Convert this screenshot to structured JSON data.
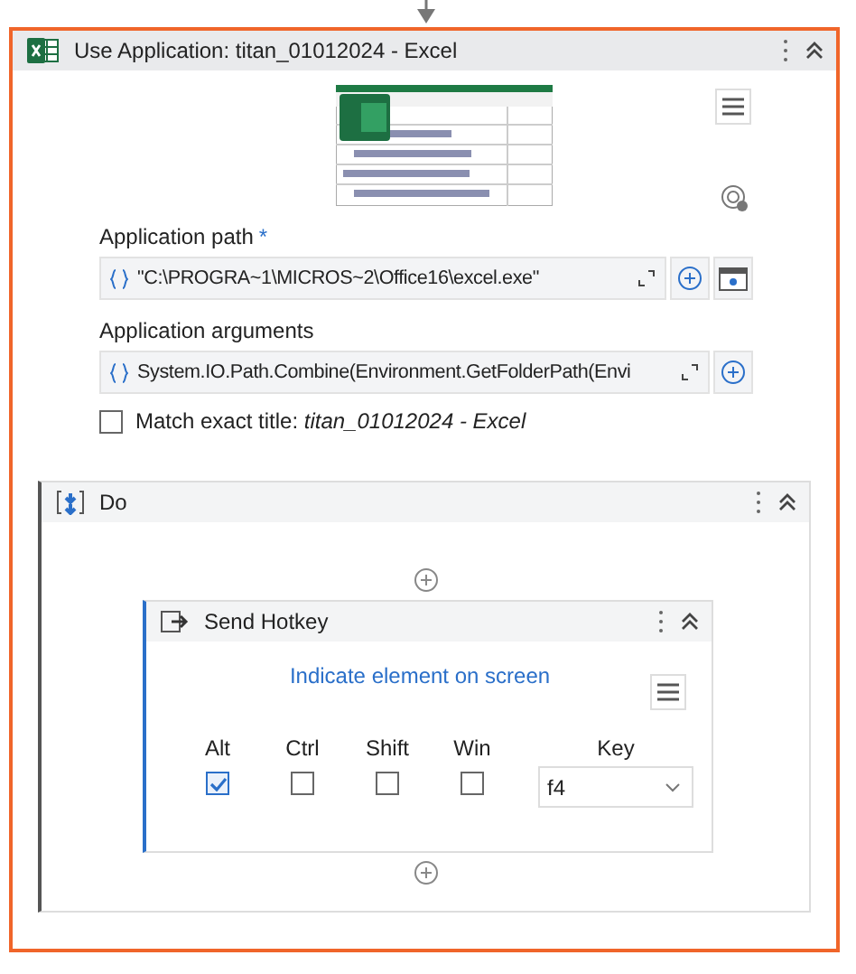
{
  "activity": {
    "title": "Use Application: titan_01012024 - Excel",
    "fields": [
      {
        "label": "Application path",
        "required_mark": "*",
        "value": "\"C:\\PROGRA~1\\MICROS~2\\Office16\\excel.exe\"",
        "browse": true
      },
      {
        "label": "Application arguments",
        "value": "System.IO.Path.Combine(Environment.GetFolderPath(Envi",
        "browse": false
      }
    ],
    "match_exact_title": {
      "label": "Match exact title: *titan_01012024 - Excel*",
      "checked": false
    },
    "do": {
      "title": "Do",
      "send_hotkey": {
        "title": "Send Hotkey",
        "indicate_link": "Indicate element on screen",
        "modifiers": [
          {
            "label": "Alt",
            "checked": true
          },
          {
            "label": "Ctrl",
            "checked": false
          },
          {
            "label": "Shift",
            "checked": false
          },
          {
            "label": "Win",
            "checked": false
          }
        ],
        "key": {
          "label": "Key",
          "value": "f4"
        }
      }
    }
  }
}
